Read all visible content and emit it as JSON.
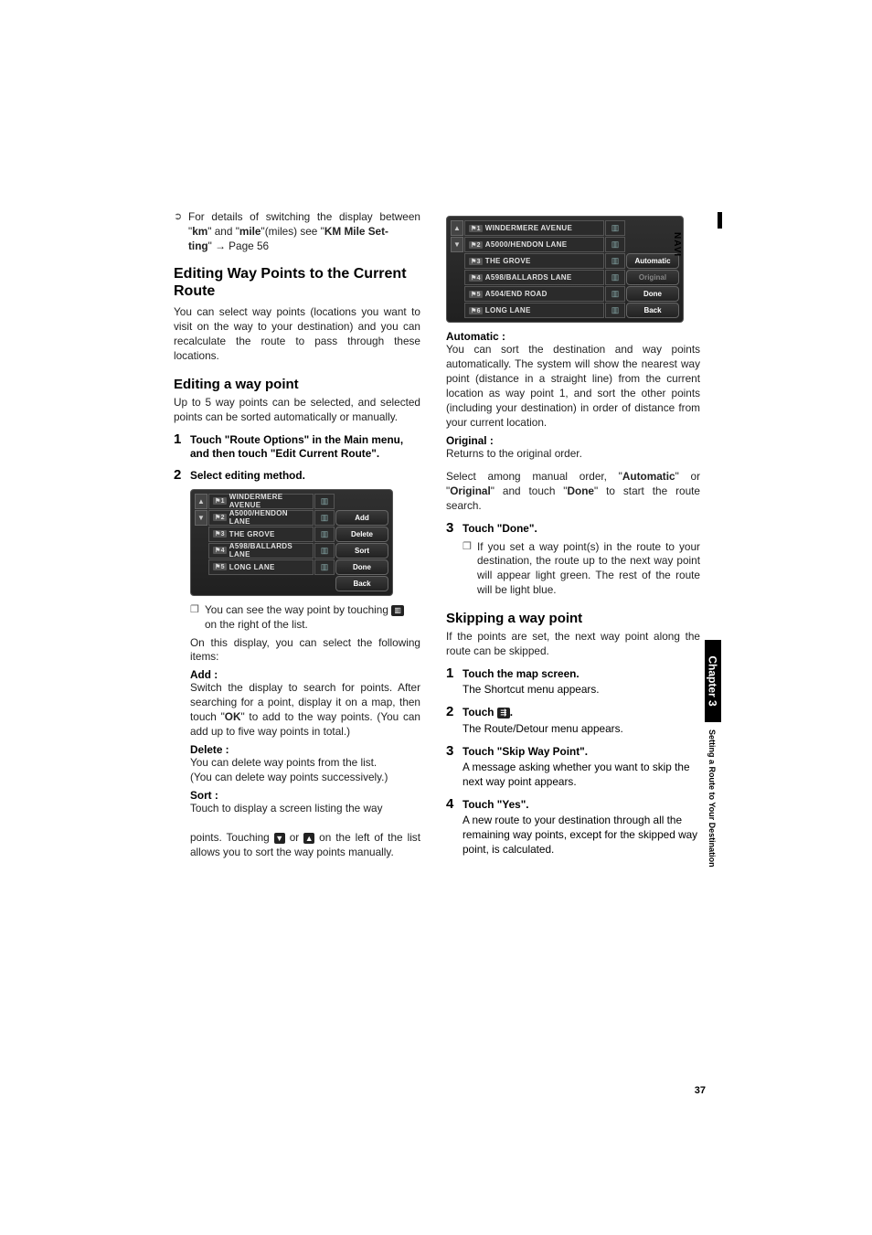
{
  "side": {
    "navi": "NAVI",
    "chapter": "Chapter 3",
    "subtitle": "Setting a Route to Your Destination"
  },
  "page_number": "37",
  "left": {
    "bullet_intro": "For details of switching the display between \"",
    "km": "km",
    "mile_mid": "\" and \"",
    "mile": "mile",
    "mile_after": "\"(miles) see \"",
    "km_mile_set": "KM Mile Set-",
    "ting_line": "ting",
    "arrow": "→",
    "page56": " Page 56",
    "h1": "Editing Way Points to the Current Route",
    "h1_body": "You can select way points (locations you want to visit on the way to your destination) and you can recalculate the route to pass through these locations.",
    "h2a": "Editing a way point",
    "h2a_body": "Up to 5 way points can be selected, and selected points can be sorted automatically or manually.",
    "step1_title": "Touch \"Route Options\" in the Main menu, and then touch \"Edit Current Route\".",
    "step2_title": "Select editing method.",
    "note1_a": "You can see the way point by touching ",
    "note1_b": " on the right of the list.",
    "after_device": "On this display, you can select the following items:",
    "add_label": "Add :",
    "add_body_a": "Switch the display to search for points. After searching for a point, display it on a map, then touch \"",
    "ok": "OK",
    "add_body_b": "\" to add to the way points. (You can add up to five way points in total.)",
    "delete_label": "Delete :",
    "delete_body": "You can delete way points from the list.\n(You can delete way points successively.)",
    "sort_label": "Sort :",
    "sort_body_a": "Touch to display a screen listing the way",
    "sort_body_b": "points. Touching ",
    "sort_body_c": " or ",
    "sort_body_d": " on the left of the list allows you to sort the way points manually."
  },
  "device1": {
    "rows": [
      "WINDERMERE AVENUE",
      "A5000/HENDON LANE",
      "THE GROVE",
      "A598/BALLARDS LANE",
      "LONG LANE"
    ],
    "buttons": [
      "Add",
      "Delete",
      "Sort",
      "Done",
      "Back"
    ]
  },
  "device2": {
    "rows": [
      "WINDERMERE AVENUE",
      "A5000/HENDON LANE",
      "THE GROVE",
      "A598/BALLARDS LANE",
      "A504/END ROAD",
      "LONG LANE"
    ],
    "buttons": [
      "Automatic",
      "Original",
      "Done",
      "Back"
    ]
  },
  "right": {
    "auto_label": "Automatic :",
    "auto_body": "You can sort the destination and way points automatically. The system will show the nearest way point (distance in a straight line) from the current location as way point 1, and sort the other points (including your destination) in order of distance from your current location.",
    "orig_label": "Original :",
    "orig_body": "Returns to the original order.",
    "select_a": "Select among manual order, \"",
    "automatic": "Automatic",
    "select_b": "\" or \"",
    "original": "Original",
    "select_c": "\" and touch \"",
    "done": "Done",
    "select_d": "\" to start the route search.",
    "step3_title": "Touch \"Done\".",
    "step3_note": "If you set a way point(s) in the route to your destination, the route up to the next way point will appear light green. The rest of the route will be light blue.",
    "h2b": "Skipping a way point",
    "h2b_body": "If the points are set, the next way point along the route can be skipped.",
    "s1_title": "Touch the map screen.",
    "s1_body": "The Shortcut menu appears.",
    "s2_title": "Touch ",
    "s2_title_after": ".",
    "s2_body": "The Route/Detour menu appears.",
    "s3_title": "Touch \"Skip Way Point\".",
    "s3_body": "A message asking whether you want to skip the next way point appears.",
    "s4_title": "Touch \"Yes\".",
    "s4_body": "A new route to your destination through all the remaining way points, except for the skipped way point, is calculated."
  },
  "nums": {
    "n1": "1",
    "n2": "2",
    "n3": "3",
    "n4": "4"
  }
}
